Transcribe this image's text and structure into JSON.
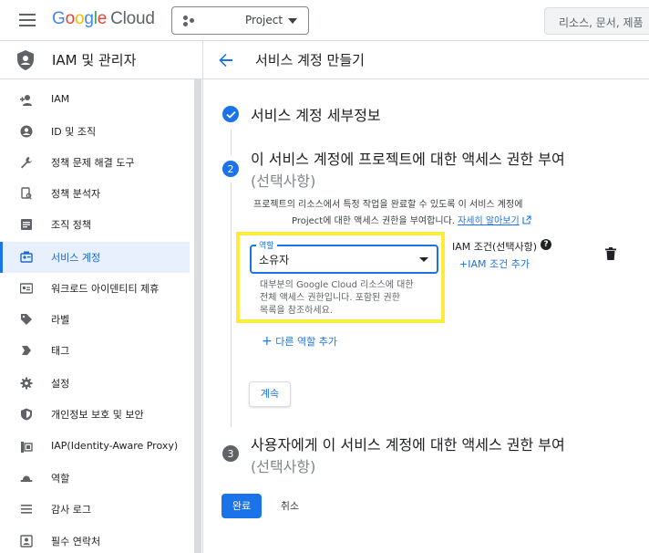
{
  "topbar": {
    "logo": {
      "google": "Google",
      "cloud": "Cloud"
    },
    "project": "Project",
    "search_placeholder": "리소스, 문서, 제품"
  },
  "sidebar": {
    "title": "IAM 및 관리자",
    "items": [
      {
        "label": "IAM",
        "icon": "person-add-icon"
      },
      {
        "label": "ID 및 조직",
        "icon": "account-circle-icon"
      },
      {
        "label": "정책 문제 해결 도구",
        "icon": "wrench-icon"
      },
      {
        "label": "정책 분석자",
        "icon": "policy-analyzer-icon"
      },
      {
        "label": "조직 정책",
        "icon": "list-icon"
      },
      {
        "label": "서비스 계정",
        "icon": "service-account-icon",
        "active": true
      },
      {
        "label": "워크로드 아이덴티티 제휴",
        "icon": "id-card-icon"
      },
      {
        "label": "라벨",
        "icon": "label-icon"
      },
      {
        "label": "태그",
        "icon": "tag-icon"
      },
      {
        "label": "설정",
        "icon": "gear-icon"
      },
      {
        "label": "개인정보 보호 및 보안",
        "icon": "shield-icon"
      },
      {
        "label": "IAP(Identity-Aware Proxy)",
        "icon": "iap-icon"
      },
      {
        "label": "역할",
        "icon": "hat-icon"
      },
      {
        "label": "감사 로그",
        "icon": "list-lines-icon"
      },
      {
        "label": "필수 연락처",
        "icon": "contacts-icon"
      }
    ]
  },
  "content": {
    "title": "서비스 계정 만들기",
    "step1": {
      "title": "서비스 계정 세부정보"
    },
    "step2": {
      "number": "2",
      "title": "이 서비스 계정에 프로젝트에 대한 액세스 권한 부여",
      "subtitle": "(선택사항)",
      "desc_line1": "프로젝트의 리소스에서 특정 작업을 완료할 수 있도록 이 서비스 계정에",
      "desc_line2": "Project에 대한 액세스 권한을 부여합니다.",
      "learn_more": "자세히 알아보기",
      "role_label": "역할",
      "role_value": "소유자",
      "role_help_1": "대부분의 Google Cloud 리소스에 대한",
      "role_help_2": "전체 액세스 권한입니다. 포함된 권한",
      "role_help_3": "목록을 참조하세요.",
      "condition_label": "IAM 조건(선택사항)",
      "add_condition": "IAM 조건 추가",
      "add_role": "다른 역할 추가",
      "continue": "계속"
    },
    "step3": {
      "number": "3",
      "title": "사용자에게 이 서비스 계정에 대한 액세스 권한 부여",
      "subtitle": "(선택사항)"
    },
    "done": "완료",
    "cancel": "취소"
  },
  "colors": {
    "accent": "#1a73e8",
    "highlight": "#ffeb3b",
    "active_bg": "#e8f0fe"
  }
}
